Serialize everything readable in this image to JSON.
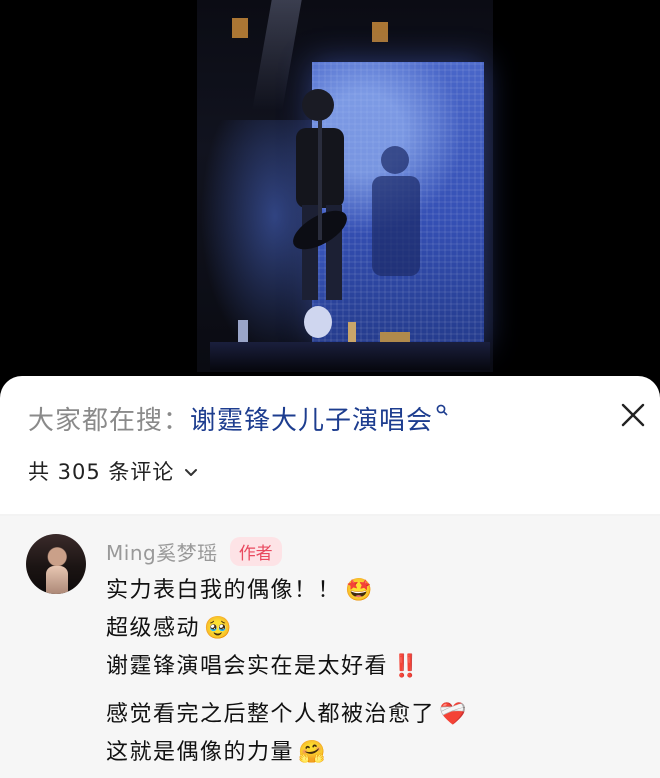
{
  "search": {
    "prefix": "大家都在搜：",
    "term": "谢霆锋大儿子演唱会",
    "close_icon": "close-icon",
    "term_icon": "search-icon"
  },
  "comments_header": {
    "count_label": "共 305 条评论",
    "chevron_icon": "chevron-down-icon"
  },
  "comment": {
    "author": "Ming奚梦瑶",
    "tag": "作者",
    "lines": [
      {
        "text": "实力表白我的偶像！！",
        "emoji": "🤩"
      },
      {
        "text": "超级感动",
        "emoji": "🥹"
      },
      {
        "text": "谢霆锋演唱会实在是太好看",
        "emoji": "‼️"
      },
      {
        "text": "感觉看完之后整个人都被治愈了",
        "emoji": "❤️‍🩹"
      },
      {
        "text": "这就是偶像的力量",
        "emoji": "🤗"
      }
    ]
  },
  "colors": {
    "search_term": "#1d3d8f",
    "tag_text": "#e9495f",
    "tag_bg": "#fde3e6",
    "comment_bg": "#f6f6f6"
  }
}
